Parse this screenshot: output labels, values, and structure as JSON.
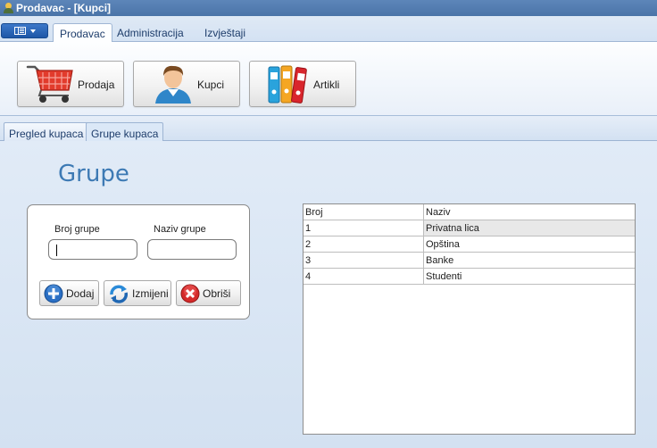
{
  "window": {
    "title": "Prodavac - [Kupci]"
  },
  "ribbon": {
    "tabs": [
      "Prodavac",
      "Administracija",
      "Izvještaji"
    ],
    "buttons": {
      "prodaja": "Prodaja",
      "kupci": "Kupci",
      "artikli": "Artikli"
    }
  },
  "doc_tabs": [
    "Pregled kupaca",
    "Grupe kupaca"
  ],
  "main": {
    "heading": "Grupe",
    "form": {
      "broj_label": "Broj grupe",
      "naziv_label": "Naziv grupe",
      "broj_value": "",
      "naziv_value": "",
      "add_label": "Dodaj",
      "edit_label": "Izmijeni",
      "delete_label": "Obriši"
    },
    "grid": {
      "columns": [
        "Broj",
        "Naziv"
      ],
      "rows": [
        {
          "broj": "1",
          "naziv": "Privatna lica"
        },
        {
          "broj": "2",
          "naziv": "Opština"
        },
        {
          "broj": "3",
          "naziv": "Banke"
        },
        {
          "broj": "4",
          "naziv": "Studenti"
        }
      ]
    }
  },
  "colors": {
    "title_bar": "#4a74a8",
    "heading": "#3d7ab4",
    "accent": "#1e57a7"
  }
}
